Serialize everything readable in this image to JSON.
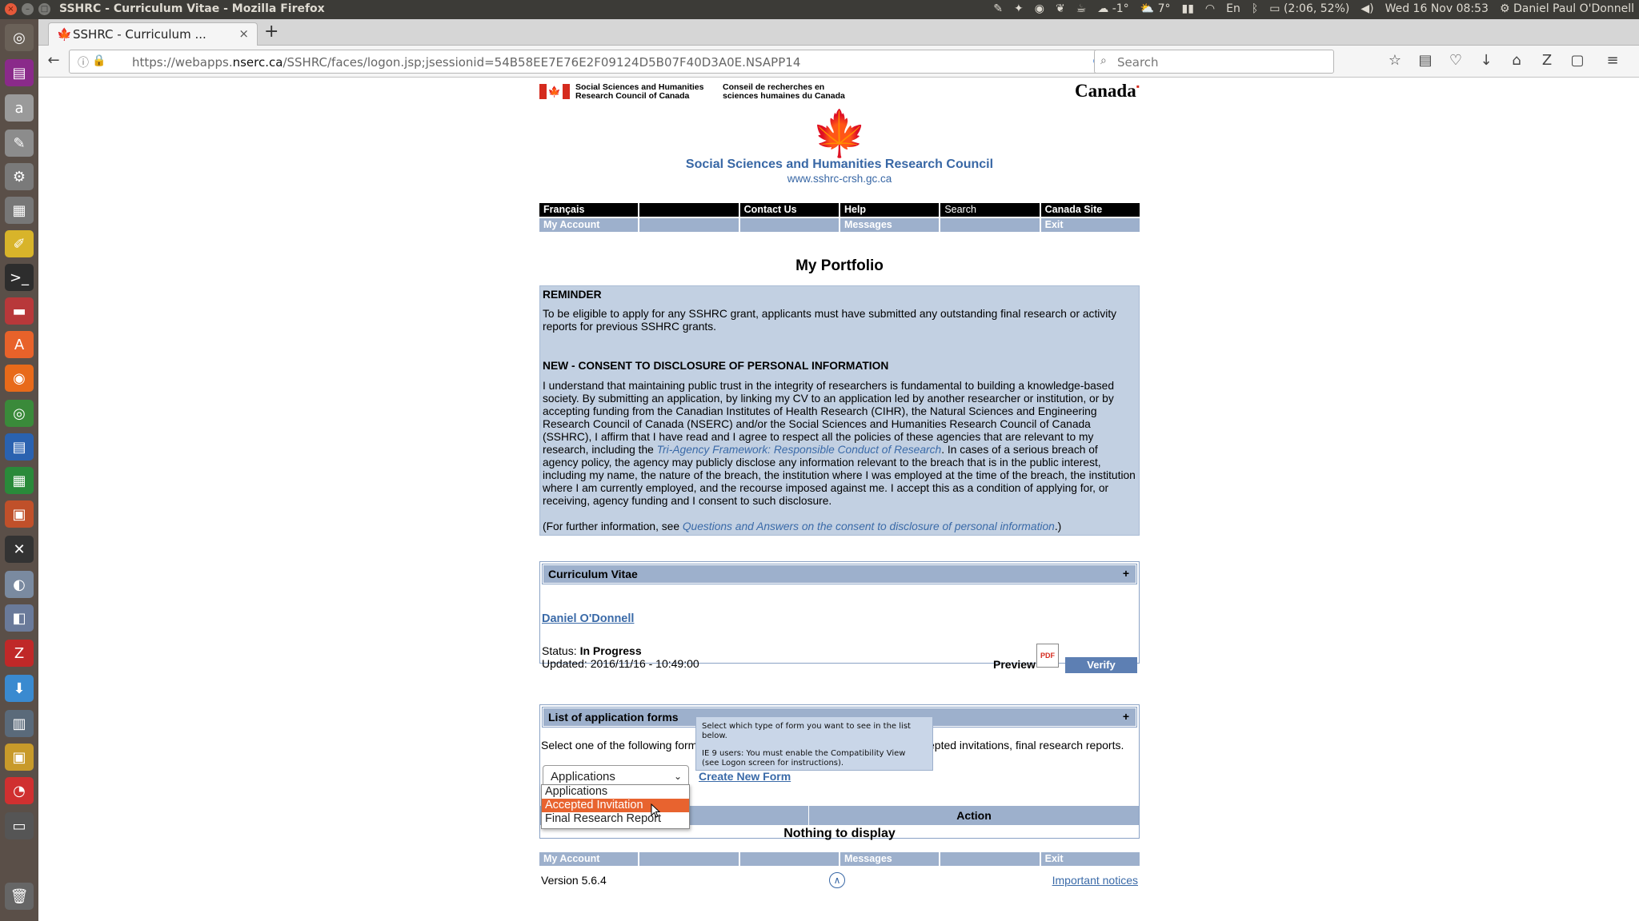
{
  "system_bar": {
    "window_title": "SSHRC - Curriculum Vitae - Mozilla Firefox",
    "weather1": "-1°",
    "weather2": "7°",
    "keyboard_layout": "En",
    "battery": "(2:06, 52%)",
    "datetime": "Wed 16 Nov 08:53",
    "user_name": "Daniel Paul O'Donnell"
  },
  "browser": {
    "tab_title": "SSHRC - Curriculum ...",
    "url_prefix": "https://webapps.",
    "url_host": "nserc.ca",
    "url_path": "/SSHRC/faces/logon.jsp;jsessionid=54B58EE7E76E2F09124D5B07F40D3A0E.NSAPP14",
    "search_placeholder": "Search"
  },
  "header": {
    "dept_name_en_1": "Social Sciences and Humanities",
    "dept_name_en_2": "Research Council of Canada",
    "dept_name_fr_1": "Conseil de recherches en",
    "dept_name_fr_2": "sciences humaines du Canada",
    "wordmark": "Canada",
    "org_name": "Social Sciences and Humanities Research Council",
    "org_url": "www.sshrc-crsh.gc.ca"
  },
  "menu": {
    "row1": [
      "Français",
      "",
      "Contact Us",
      "Help",
      "Search",
      "Canada Site"
    ],
    "row2": [
      "My Account",
      "",
      "",
      "Messages",
      "",
      "Exit"
    ]
  },
  "page_title": "My Portfolio",
  "reminder": {
    "heading": "REMINDER",
    "text": "To be eligible to apply for any SSHRC grant, applicants must have submitted any outstanding final research or activity reports for previous SSHRC grants.",
    "consent_heading": "NEW - CONSENT TO DISCLOSURE OF PERSONAL INFORMATION",
    "consent_text_1": "I understand that maintaining public trust in the integrity of researchers is fundamental to building a knowledge-based society. By submitting an application, by linking my CV to an application led by another researcher or institution, or by accepting funding from the Canadian Institutes of Health Research (CIHR), the Natural Sciences and Engineering Research Council of Canada (NSERC) and/or the Social Sciences and Humanities Research Council of Canada (SSHRC), I affirm that I have read and I agree to respect all the policies of these agencies that are relevant to my research, including the ",
    "consent_link": "Tri-Agency Framework: Responsible Conduct of Research",
    "consent_text_2": ". In cases of a serious breach of agency policy, the agency may publicly disclose any information relevant to the breach that is in the public interest, including my name, the nature of the breach, the institution where I was employed at the time of the breach, the institution where I am currently employed, and the recourse imposed against me. I accept this as a condition of applying for, or receiving, agency funding and I consent to such disclosure.",
    "further_prefix": "(For further information, see ",
    "further_link": "Questions and Answers on the consent to disclosure of personal information",
    "further_suffix": ".)"
  },
  "cv_panel": {
    "title": "Curriculum Vitae",
    "toggle": "+",
    "name": "Daniel O'Donnell",
    "status_label": "Status:",
    "status_value": "In Progress",
    "updated": "Updated: 2016/11/16 - 10:49:00",
    "preview": "Preview",
    "pdf_label": "PDF",
    "verify": "Verify"
  },
  "apps_panel": {
    "title": "List of application forms",
    "toggle": "+",
    "instruction_start": "Select one of the following form",
    "instruction_end": "epted invitations, final research reports.",
    "select_value": "Applications",
    "create_new": "Create New Form",
    "col_action": "Action",
    "empty": "Nothing to display"
  },
  "tooltip": {
    "line1": "Select which type of form you want to see in the list below.",
    "line2": "IE 9 users: You must enable the Compatibility View",
    "line3": "(see Logon screen for instructions)."
  },
  "dropdown": {
    "options": [
      "Applications",
      "Accepted Invitation",
      "Final Research Report"
    ],
    "selected_index": 1
  },
  "footer": {
    "version": "Version 5.6.4",
    "notices": "Important notices"
  }
}
